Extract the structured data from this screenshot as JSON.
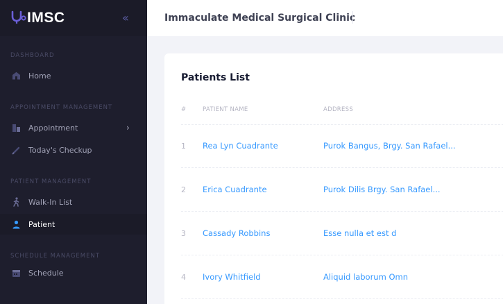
{
  "brand": {
    "name": "IMSC",
    "collapse_icon": "double-chevron-left-icon"
  },
  "header": {
    "title": "Immaculate Medical Surgical Clinic"
  },
  "sidebar": {
    "sections": [
      {
        "title": "DASHBOARD"
      },
      {
        "title": "APPOINTMENT MANAGEMENT"
      },
      {
        "title": "PATIENT MANAGEMENT"
      },
      {
        "title": "SCHEDULE MANAGEMENT"
      }
    ],
    "items": [
      {
        "label": "Home",
        "icon": "home-icon"
      },
      {
        "label": "Appointment",
        "icon": "appointment-icon",
        "has_submenu": true
      },
      {
        "label": "Today's Checkup",
        "icon": "pencil-icon"
      },
      {
        "label": "Walk-In List",
        "icon": "walking-person-icon"
      },
      {
        "label": "Patient",
        "icon": "user-icon",
        "active": true
      },
      {
        "label": "Schedule",
        "icon": "calendar-icon"
      }
    ]
  },
  "patients": {
    "title": "Patients List",
    "columns": [
      "#",
      "PATIENT NAME",
      "ADDRESS"
    ],
    "rows": [
      {
        "num": "1",
        "name": "Rea Lyn Cuadrante",
        "address": "Purok Bangus, Brgy. San Rafael..."
      },
      {
        "num": "2",
        "name": "Erica Cuadrante",
        "address": "Purok Dilis Brgy. San Rafael..."
      },
      {
        "num": "3",
        "name": "Cassady Robbins",
        "address": "Esse nulla et est d"
      },
      {
        "num": "4",
        "name": "Ivory Whitfield",
        "address": "Aliquid laborum Omn"
      }
    ]
  },
  "colors": {
    "sidebar_bg": "#1e1e2d",
    "accent": "#3699ff",
    "logo": "#5d5fd8"
  }
}
